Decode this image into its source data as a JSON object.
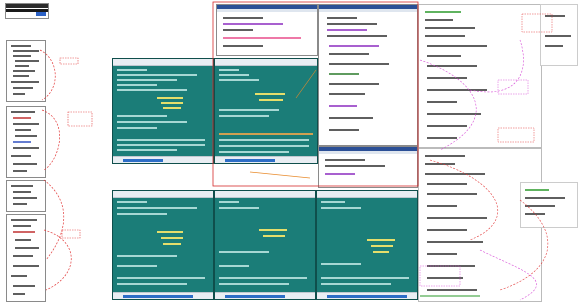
{
  "screens": {
    "note": ""
  },
  "labels": {
    "top_left_tag": "",
    "mid_label": "",
    "right_label": ""
  }
}
